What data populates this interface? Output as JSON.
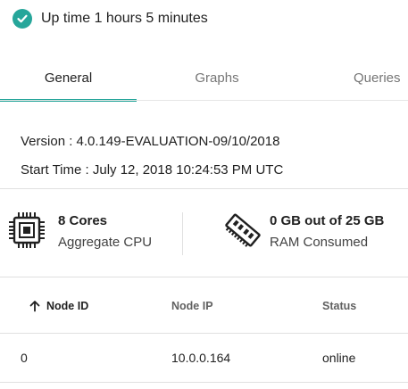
{
  "uptime": {
    "text": "Up time 1 hours 5 minutes",
    "icon": "check-circle-icon",
    "color": "#26a69a"
  },
  "tabs": [
    {
      "label": "General",
      "active": true
    },
    {
      "label": "Graphs",
      "active": false
    },
    {
      "label": "Queries",
      "active": false
    }
  ],
  "info": {
    "version": "Version : 4.0.149-EVALUATION-09/10/2018",
    "start_time": "Start Time : July 12, 2018 10:24:53 PM UTC"
  },
  "stats": {
    "cpu": {
      "value": "8 Cores",
      "label": "Aggregate CPU",
      "icon": "cpu-chip-icon"
    },
    "ram": {
      "value": "0 GB out of 25 GB",
      "label": "RAM Consumed",
      "icon": "memory-module-icon"
    }
  },
  "table": {
    "columns": [
      "Node ID",
      "Node IP",
      "Status"
    ],
    "sort_column": "Node ID",
    "sort_direction": "ascending",
    "rows": [
      {
        "node_id": "0",
        "node_ip": "10.0.0.164",
        "status": "online"
      }
    ]
  },
  "accent_color": "#26a69a"
}
